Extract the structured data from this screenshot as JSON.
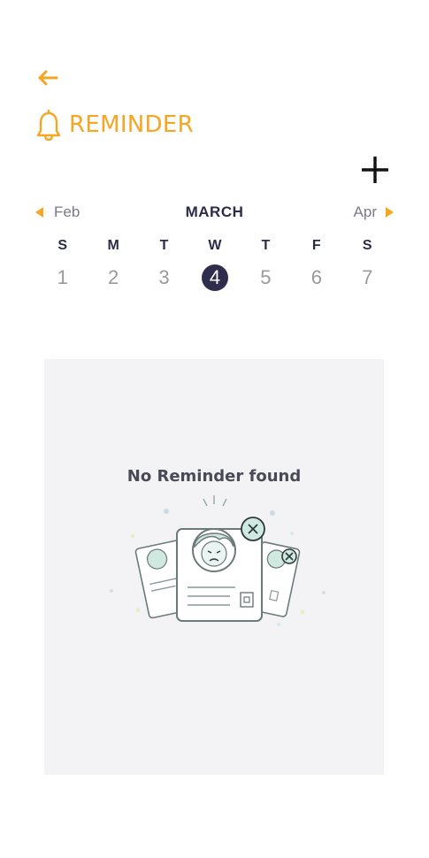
{
  "header": {
    "title": "REMINDER"
  },
  "calendar": {
    "prev_month": "Feb",
    "current_month": "MARCH",
    "next_month": "Apr",
    "weekdays": [
      "S",
      "M",
      "T",
      "W",
      "T",
      "F",
      "S"
    ],
    "dates": [
      "1",
      "2",
      "3",
      "4",
      "5",
      "6",
      "7"
    ],
    "selected_date": "4"
  },
  "empty_state": {
    "message": "No Reminder found"
  },
  "colors": {
    "accent": "#F5A623",
    "selected": "#2f2d4d",
    "panel": "#f3f3f6"
  }
}
